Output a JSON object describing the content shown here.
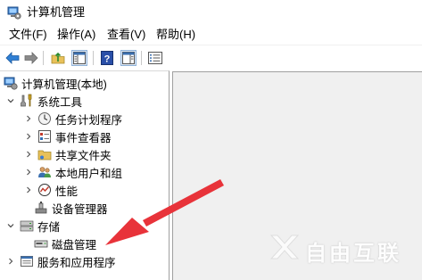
{
  "window": {
    "title": "计算机管理",
    "icon": "computer-management-icon"
  },
  "menu": {
    "items": [
      "文件(F)",
      "操作(A)",
      "查看(V)",
      "帮助(H)"
    ]
  },
  "toolbar": {
    "buttons": [
      "back-icon",
      "forward-icon",
      "up-folder-icon",
      "show-hide-console-tree-icon",
      "help-icon",
      "show-hide-action-pane-icon",
      "properties-icon"
    ]
  },
  "tree": {
    "root": "计算机管理(本地)",
    "system_tools": "系统工具",
    "task_scheduler": "任务计划程序",
    "event_viewer": "事件查看器",
    "shared_folders": "共享文件夹",
    "local_users": "本地用户和组",
    "performance": "性能",
    "device_manager": "设备管理器",
    "storage": "存储",
    "disk_management": "磁盘管理",
    "services_apps": "服务和应用程序"
  },
  "watermark": {
    "text": "自由互联"
  },
  "colors": {
    "arrow": "#e8333a",
    "pane_bg": "#f0f0f0",
    "border": "#a0a0a0"
  }
}
